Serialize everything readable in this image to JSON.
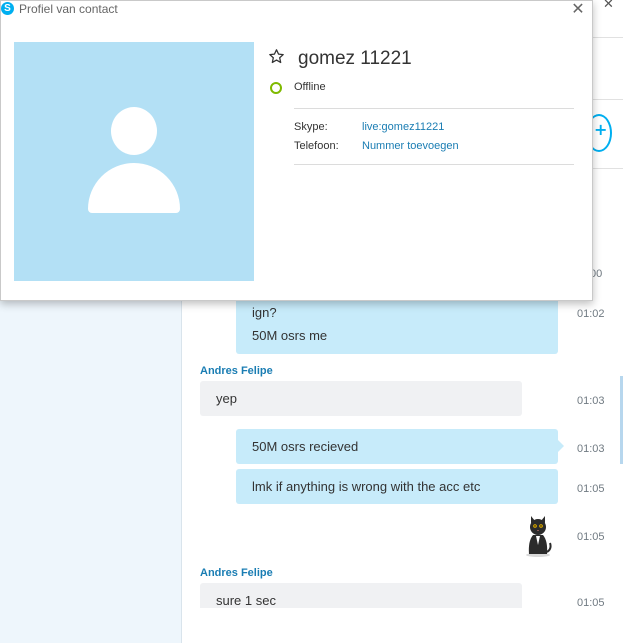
{
  "dialog": {
    "title": "Profiel van contact",
    "close_glyph": "✕",
    "contact_name": "gomez 11221",
    "status": "Offline",
    "fields": [
      {
        "label": "Skype:",
        "value": "live:gomez11221"
      },
      {
        "label": "Telefoon:",
        "value": "Nummer toevoegen"
      }
    ]
  },
  "background": {
    "close_glyph": "✕",
    "add_glyph": "+",
    "partial_time": "00"
  },
  "messages": [
    {
      "lines": [
        "ign?",
        "50M osrs me"
      ],
      "time": "01:02",
      "direction": "out"
    },
    {
      "sender": "Andres Felipe",
      "lines": [
        "yep"
      ],
      "time": "01:03",
      "direction": "in"
    },
    {
      "lines": [
        "50M osrs recieved"
      ],
      "time": "01:03",
      "direction": "out"
    },
    {
      "lines": [
        "lmk if anything is wrong with the acc etc"
      ],
      "time": "01:05",
      "direction": "out"
    },
    {
      "sticker": "cat-sticker",
      "time": "01:05",
      "direction": "out"
    },
    {
      "sender": "Andres Felipe",
      "lines": [
        "sure 1 sec"
      ],
      "time": "01:05",
      "direction": "in"
    }
  ],
  "icons": {
    "logo": "skype-logo-icon",
    "star": "star-outline-icon",
    "status": "offline-status-icon",
    "avatar": "default-avatar-icon",
    "sticker": "cat-sticker-icon"
  },
  "colors": {
    "accent": "#00aff0",
    "link": "#1a7db3",
    "outgoing_bubble": "#c7ebfa",
    "incoming_bubble": "#f0f1f3",
    "avatar_bg": "#b3e0f5",
    "offline": "#7fba00"
  }
}
